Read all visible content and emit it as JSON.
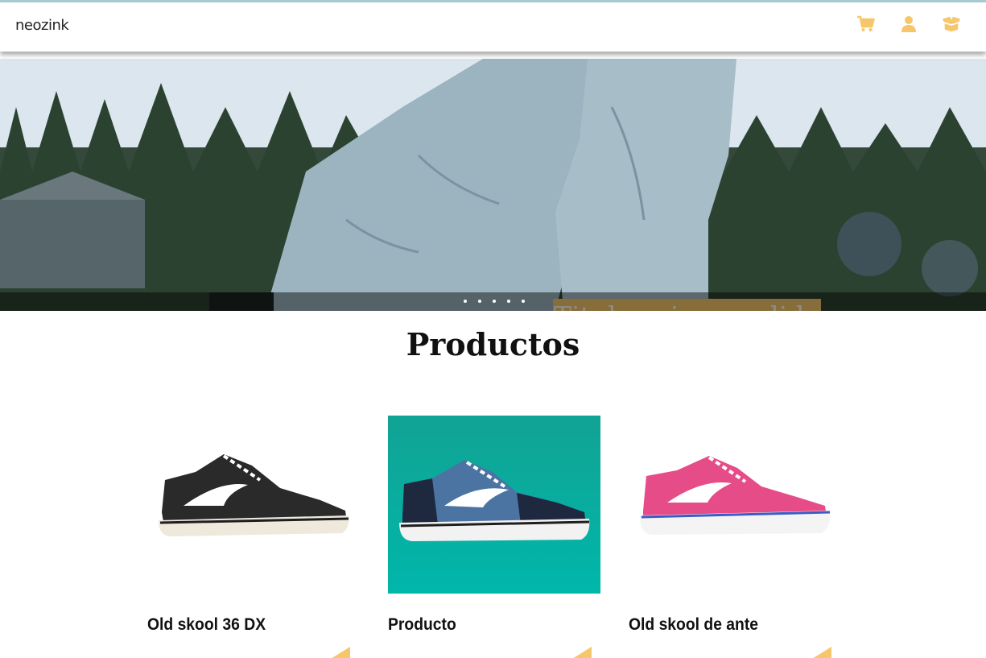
{
  "navbar": {
    "logo": "neozink",
    "icons": [
      "cart-icon",
      "user-icon",
      "box-icon"
    ],
    "accent_color": "#f6c76a"
  },
  "hero": {
    "slide_title": "Titulo primera slide",
    "slide_count": 5,
    "active_slide": 1
  },
  "products": {
    "section_title": "Productos",
    "items": [
      {
        "name": "Old skool 36 DX",
        "image": "black-sneaker"
      },
      {
        "name": "Producto",
        "image": "blue-sneaker-teal-background"
      },
      {
        "name": "Old skool de ante",
        "image": "pink-sneaker"
      }
    ]
  }
}
